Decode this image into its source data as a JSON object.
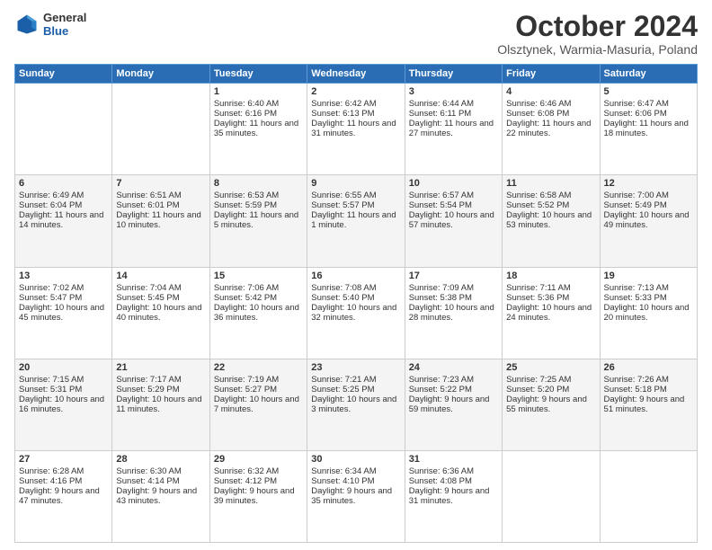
{
  "header": {
    "logo_general": "General",
    "logo_blue": "Blue",
    "month_title": "October 2024",
    "subtitle": "Olsztynek, Warmia-Masuria, Poland"
  },
  "weekdays": [
    "Sunday",
    "Monday",
    "Tuesday",
    "Wednesday",
    "Thursday",
    "Friday",
    "Saturday"
  ],
  "weeks": [
    [
      {
        "day": "",
        "sunrise": "",
        "sunset": "",
        "daylight": ""
      },
      {
        "day": "",
        "sunrise": "",
        "sunset": "",
        "daylight": ""
      },
      {
        "day": "1",
        "sunrise": "Sunrise: 6:40 AM",
        "sunset": "Sunset: 6:16 PM",
        "daylight": "Daylight: 11 hours and 35 minutes."
      },
      {
        "day": "2",
        "sunrise": "Sunrise: 6:42 AM",
        "sunset": "Sunset: 6:13 PM",
        "daylight": "Daylight: 11 hours and 31 minutes."
      },
      {
        "day": "3",
        "sunrise": "Sunrise: 6:44 AM",
        "sunset": "Sunset: 6:11 PM",
        "daylight": "Daylight: 11 hours and 27 minutes."
      },
      {
        "day": "4",
        "sunrise": "Sunrise: 6:46 AM",
        "sunset": "Sunset: 6:08 PM",
        "daylight": "Daylight: 11 hours and 22 minutes."
      },
      {
        "day": "5",
        "sunrise": "Sunrise: 6:47 AM",
        "sunset": "Sunset: 6:06 PM",
        "daylight": "Daylight: 11 hours and 18 minutes."
      }
    ],
    [
      {
        "day": "6",
        "sunrise": "Sunrise: 6:49 AM",
        "sunset": "Sunset: 6:04 PM",
        "daylight": "Daylight: 11 hours and 14 minutes."
      },
      {
        "day": "7",
        "sunrise": "Sunrise: 6:51 AM",
        "sunset": "Sunset: 6:01 PM",
        "daylight": "Daylight: 11 hours and 10 minutes."
      },
      {
        "day": "8",
        "sunrise": "Sunrise: 6:53 AM",
        "sunset": "Sunset: 5:59 PM",
        "daylight": "Daylight: 11 hours and 5 minutes."
      },
      {
        "day": "9",
        "sunrise": "Sunrise: 6:55 AM",
        "sunset": "Sunset: 5:57 PM",
        "daylight": "Daylight: 11 hours and 1 minute."
      },
      {
        "day": "10",
        "sunrise": "Sunrise: 6:57 AM",
        "sunset": "Sunset: 5:54 PM",
        "daylight": "Daylight: 10 hours and 57 minutes."
      },
      {
        "day": "11",
        "sunrise": "Sunrise: 6:58 AM",
        "sunset": "Sunset: 5:52 PM",
        "daylight": "Daylight: 10 hours and 53 minutes."
      },
      {
        "day": "12",
        "sunrise": "Sunrise: 7:00 AM",
        "sunset": "Sunset: 5:49 PM",
        "daylight": "Daylight: 10 hours and 49 minutes."
      }
    ],
    [
      {
        "day": "13",
        "sunrise": "Sunrise: 7:02 AM",
        "sunset": "Sunset: 5:47 PM",
        "daylight": "Daylight: 10 hours and 45 minutes."
      },
      {
        "day": "14",
        "sunrise": "Sunrise: 7:04 AM",
        "sunset": "Sunset: 5:45 PM",
        "daylight": "Daylight: 10 hours and 40 minutes."
      },
      {
        "day": "15",
        "sunrise": "Sunrise: 7:06 AM",
        "sunset": "Sunset: 5:42 PM",
        "daylight": "Daylight: 10 hours and 36 minutes."
      },
      {
        "day": "16",
        "sunrise": "Sunrise: 7:08 AM",
        "sunset": "Sunset: 5:40 PM",
        "daylight": "Daylight: 10 hours and 32 minutes."
      },
      {
        "day": "17",
        "sunrise": "Sunrise: 7:09 AM",
        "sunset": "Sunset: 5:38 PM",
        "daylight": "Daylight: 10 hours and 28 minutes."
      },
      {
        "day": "18",
        "sunrise": "Sunrise: 7:11 AM",
        "sunset": "Sunset: 5:36 PM",
        "daylight": "Daylight: 10 hours and 24 minutes."
      },
      {
        "day": "19",
        "sunrise": "Sunrise: 7:13 AM",
        "sunset": "Sunset: 5:33 PM",
        "daylight": "Daylight: 10 hours and 20 minutes."
      }
    ],
    [
      {
        "day": "20",
        "sunrise": "Sunrise: 7:15 AM",
        "sunset": "Sunset: 5:31 PM",
        "daylight": "Daylight: 10 hours and 16 minutes."
      },
      {
        "day": "21",
        "sunrise": "Sunrise: 7:17 AM",
        "sunset": "Sunset: 5:29 PM",
        "daylight": "Daylight: 10 hours and 11 minutes."
      },
      {
        "day": "22",
        "sunrise": "Sunrise: 7:19 AM",
        "sunset": "Sunset: 5:27 PM",
        "daylight": "Daylight: 10 hours and 7 minutes."
      },
      {
        "day": "23",
        "sunrise": "Sunrise: 7:21 AM",
        "sunset": "Sunset: 5:25 PM",
        "daylight": "Daylight: 10 hours and 3 minutes."
      },
      {
        "day": "24",
        "sunrise": "Sunrise: 7:23 AM",
        "sunset": "Sunset: 5:22 PM",
        "daylight": "Daylight: 9 hours and 59 minutes."
      },
      {
        "day": "25",
        "sunrise": "Sunrise: 7:25 AM",
        "sunset": "Sunset: 5:20 PM",
        "daylight": "Daylight: 9 hours and 55 minutes."
      },
      {
        "day": "26",
        "sunrise": "Sunrise: 7:26 AM",
        "sunset": "Sunset: 5:18 PM",
        "daylight": "Daylight: 9 hours and 51 minutes."
      }
    ],
    [
      {
        "day": "27",
        "sunrise": "Sunrise: 6:28 AM",
        "sunset": "Sunset: 4:16 PM",
        "daylight": "Daylight: 9 hours and 47 minutes."
      },
      {
        "day": "28",
        "sunrise": "Sunrise: 6:30 AM",
        "sunset": "Sunset: 4:14 PM",
        "daylight": "Daylight: 9 hours and 43 minutes."
      },
      {
        "day": "29",
        "sunrise": "Sunrise: 6:32 AM",
        "sunset": "Sunset: 4:12 PM",
        "daylight": "Daylight: 9 hours and 39 minutes."
      },
      {
        "day": "30",
        "sunrise": "Sunrise: 6:34 AM",
        "sunset": "Sunset: 4:10 PM",
        "daylight": "Daylight: 9 hours and 35 minutes."
      },
      {
        "day": "31",
        "sunrise": "Sunrise: 6:36 AM",
        "sunset": "Sunset: 4:08 PM",
        "daylight": "Daylight: 9 hours and 31 minutes."
      },
      {
        "day": "",
        "sunrise": "",
        "sunset": "",
        "daylight": ""
      },
      {
        "day": "",
        "sunrise": "",
        "sunset": "",
        "daylight": ""
      }
    ]
  ]
}
